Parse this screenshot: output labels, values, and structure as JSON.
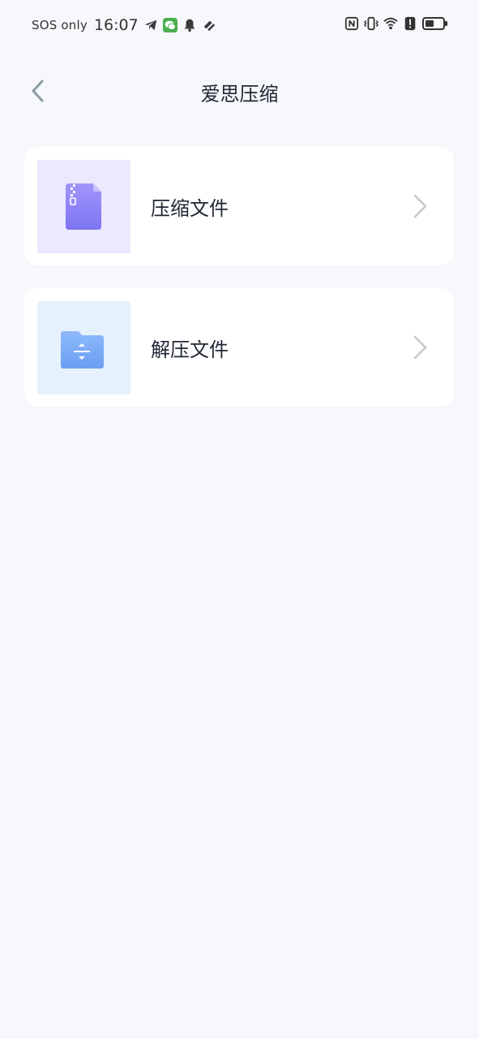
{
  "status_bar": {
    "carrier": "SOS only",
    "time": "16:07",
    "left_icons": [
      "telegram-icon",
      "wechat-icon",
      "bell-icon",
      "app-icon"
    ],
    "right_icons": [
      "nfc-icon",
      "vibrate-icon",
      "wifi-icon",
      "alert-icon",
      "battery-icon"
    ]
  },
  "header": {
    "title": "爱思压缩",
    "back_icon": "chevron-left-icon"
  },
  "items": [
    {
      "label": "压缩文件",
      "icon": "zip-file-icon",
      "thumb_color": "#ebe9fe",
      "icon_color": "#8b82f7"
    },
    {
      "label": "解压文件",
      "icon": "unzip-folder-icon",
      "thumb_color": "#e6f1fe",
      "icon_color": "#74a7f6"
    }
  ],
  "colors": {
    "background": "#f6f8fb",
    "card": "#ffffff",
    "chevron": "#c7c9cd"
  }
}
